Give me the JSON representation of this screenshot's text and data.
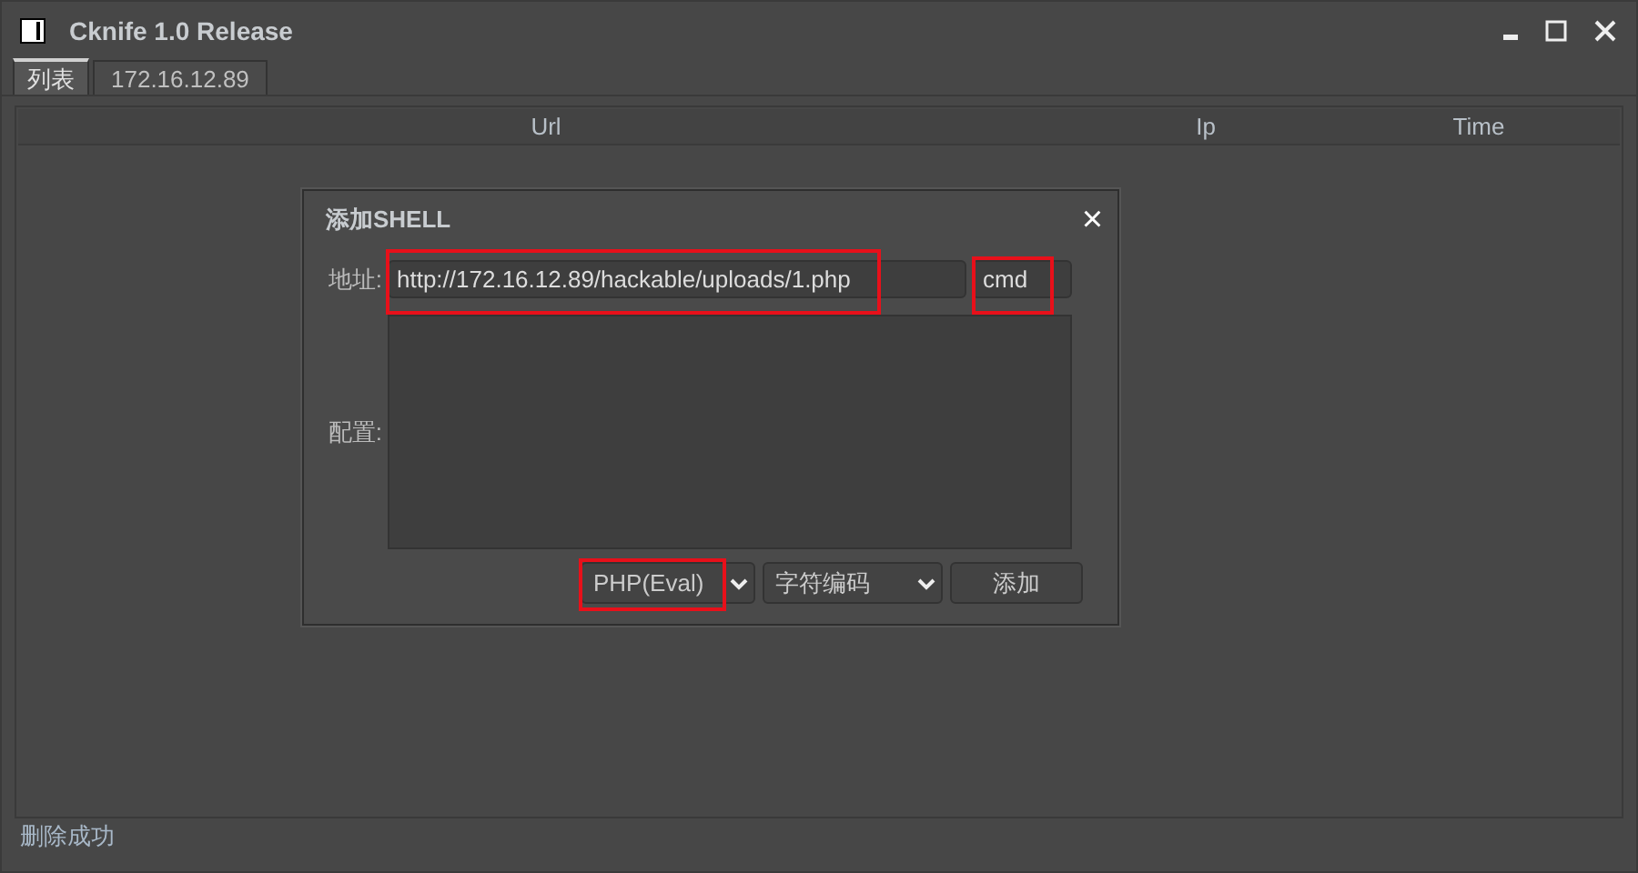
{
  "window": {
    "title": "Cknife 1.0 Release"
  },
  "tabs": [
    {
      "label": "列表",
      "selected": true
    },
    {
      "label": "172.16.12.89",
      "selected": false
    }
  ],
  "table": {
    "columns": [
      "Url",
      "Ip",
      "Time"
    ]
  },
  "dialog": {
    "title": "添加SHELL",
    "close": "×",
    "address_label": "地址:",
    "url_field": {
      "value": "http://172.16.12.89/hackable/uploads/1.php",
      "highlighted": true
    },
    "password_field": {
      "value": "cmd",
      "highlighted": true
    },
    "config_label": "配置:",
    "type_select": {
      "value": "PHP(Eval)",
      "highlighted": true
    },
    "encoding_select": {
      "value": "字符编码",
      "highlighted": false
    },
    "add_button": "添加"
  },
  "status_bar": "删除成功"
}
